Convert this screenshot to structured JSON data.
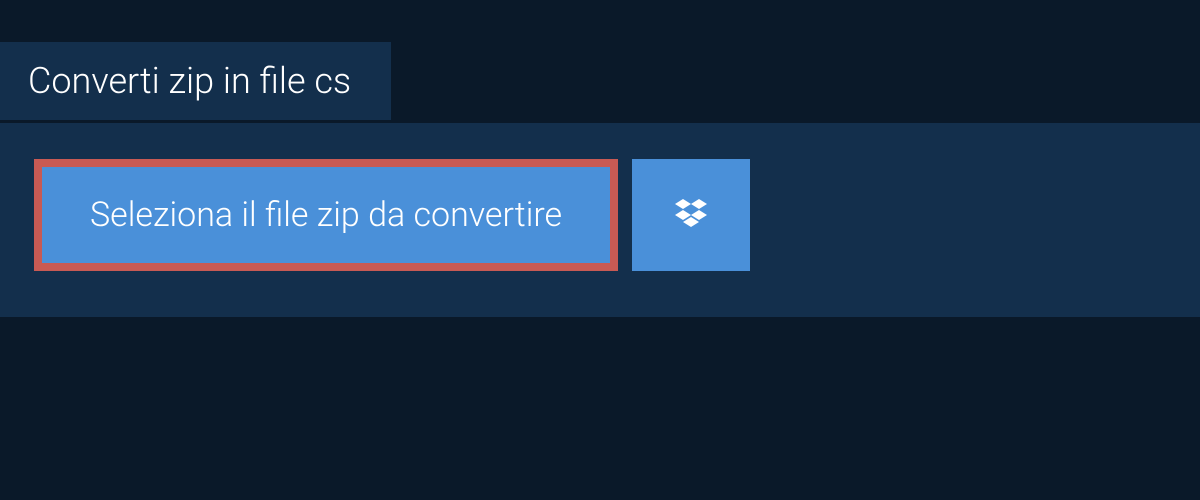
{
  "tab": {
    "title": "Converti zip in file cs"
  },
  "actions": {
    "select_file_label": "Seleziona il file zip da convertire"
  },
  "colors": {
    "background": "#0a1929",
    "panel": "#132f4c",
    "button": "#4a90d9",
    "highlight_border": "#c85a54",
    "text": "#ffffff"
  }
}
